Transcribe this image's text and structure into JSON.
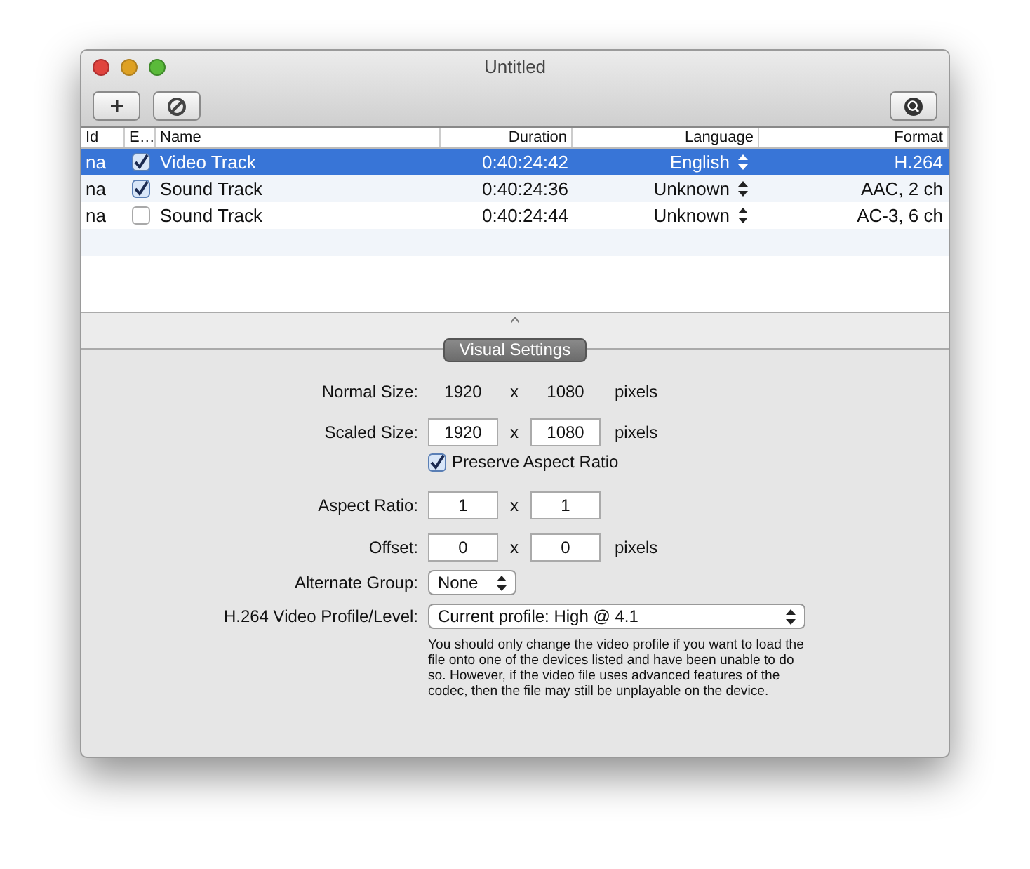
{
  "window": {
    "title": "Untitled"
  },
  "toolbar": [
    {
      "kind": "add"
    },
    {
      "kind": "disable"
    },
    {
      "kind": "inspect"
    }
  ],
  "table": {
    "columns": [
      "Id",
      "E…",
      "Name",
      "Duration",
      "Language",
      "Format"
    ],
    "rows": [
      {
        "id": "na",
        "checked": true,
        "name": "Video Track",
        "duration": "0:40:24:42",
        "language": "English",
        "format": "H.264",
        "selected": true
      },
      {
        "id": "na",
        "checked": true,
        "name": "Sound Track",
        "duration": "0:40:24:36",
        "language": "Unknown",
        "format": "AAC, 2 ch",
        "selected": false
      },
      {
        "id": "na",
        "checked": false,
        "name": "Sound Track",
        "duration": "0:40:24:44",
        "language": "Unknown",
        "format": "AC-3, 6 ch",
        "selected": false
      }
    ]
  },
  "section": {
    "title": "Visual Settings"
  },
  "settings": [
    {
      "kind": "static",
      "label": "Normal Size:",
      "a": "1920",
      "sep": "x",
      "b": "1080",
      "unit": "pixels"
    },
    {
      "kind": "pair",
      "label": "Scaled Size:",
      "a": "1920",
      "sep": "x",
      "b": "1080",
      "unit": "pixels"
    },
    {
      "kind": "checkbox",
      "text": "Preserve Aspect Ratio",
      "checked": true
    },
    {
      "kind": "pair",
      "label": "Aspect Ratio:",
      "a": "1",
      "sep": "x",
      "b": "1"
    },
    {
      "kind": "pair",
      "label": "Offset:",
      "a": "0",
      "sep": "x",
      "b": "0",
      "unit": "pixels"
    },
    {
      "kind": "popup",
      "label": "Alternate Group:",
      "value": "None"
    },
    {
      "kind": "wide-popup",
      "label": "H.264 Video Profile/Level:",
      "value": "Current profile: High @ 4.1"
    },
    {
      "kind": "note",
      "text": "You should only change the video profile if you want to load the file onto one of the devices listed and have been unable to do so.  However, if the video file uses advanced features of the codec, then the file may still be unplayable on the device."
    }
  ]
}
